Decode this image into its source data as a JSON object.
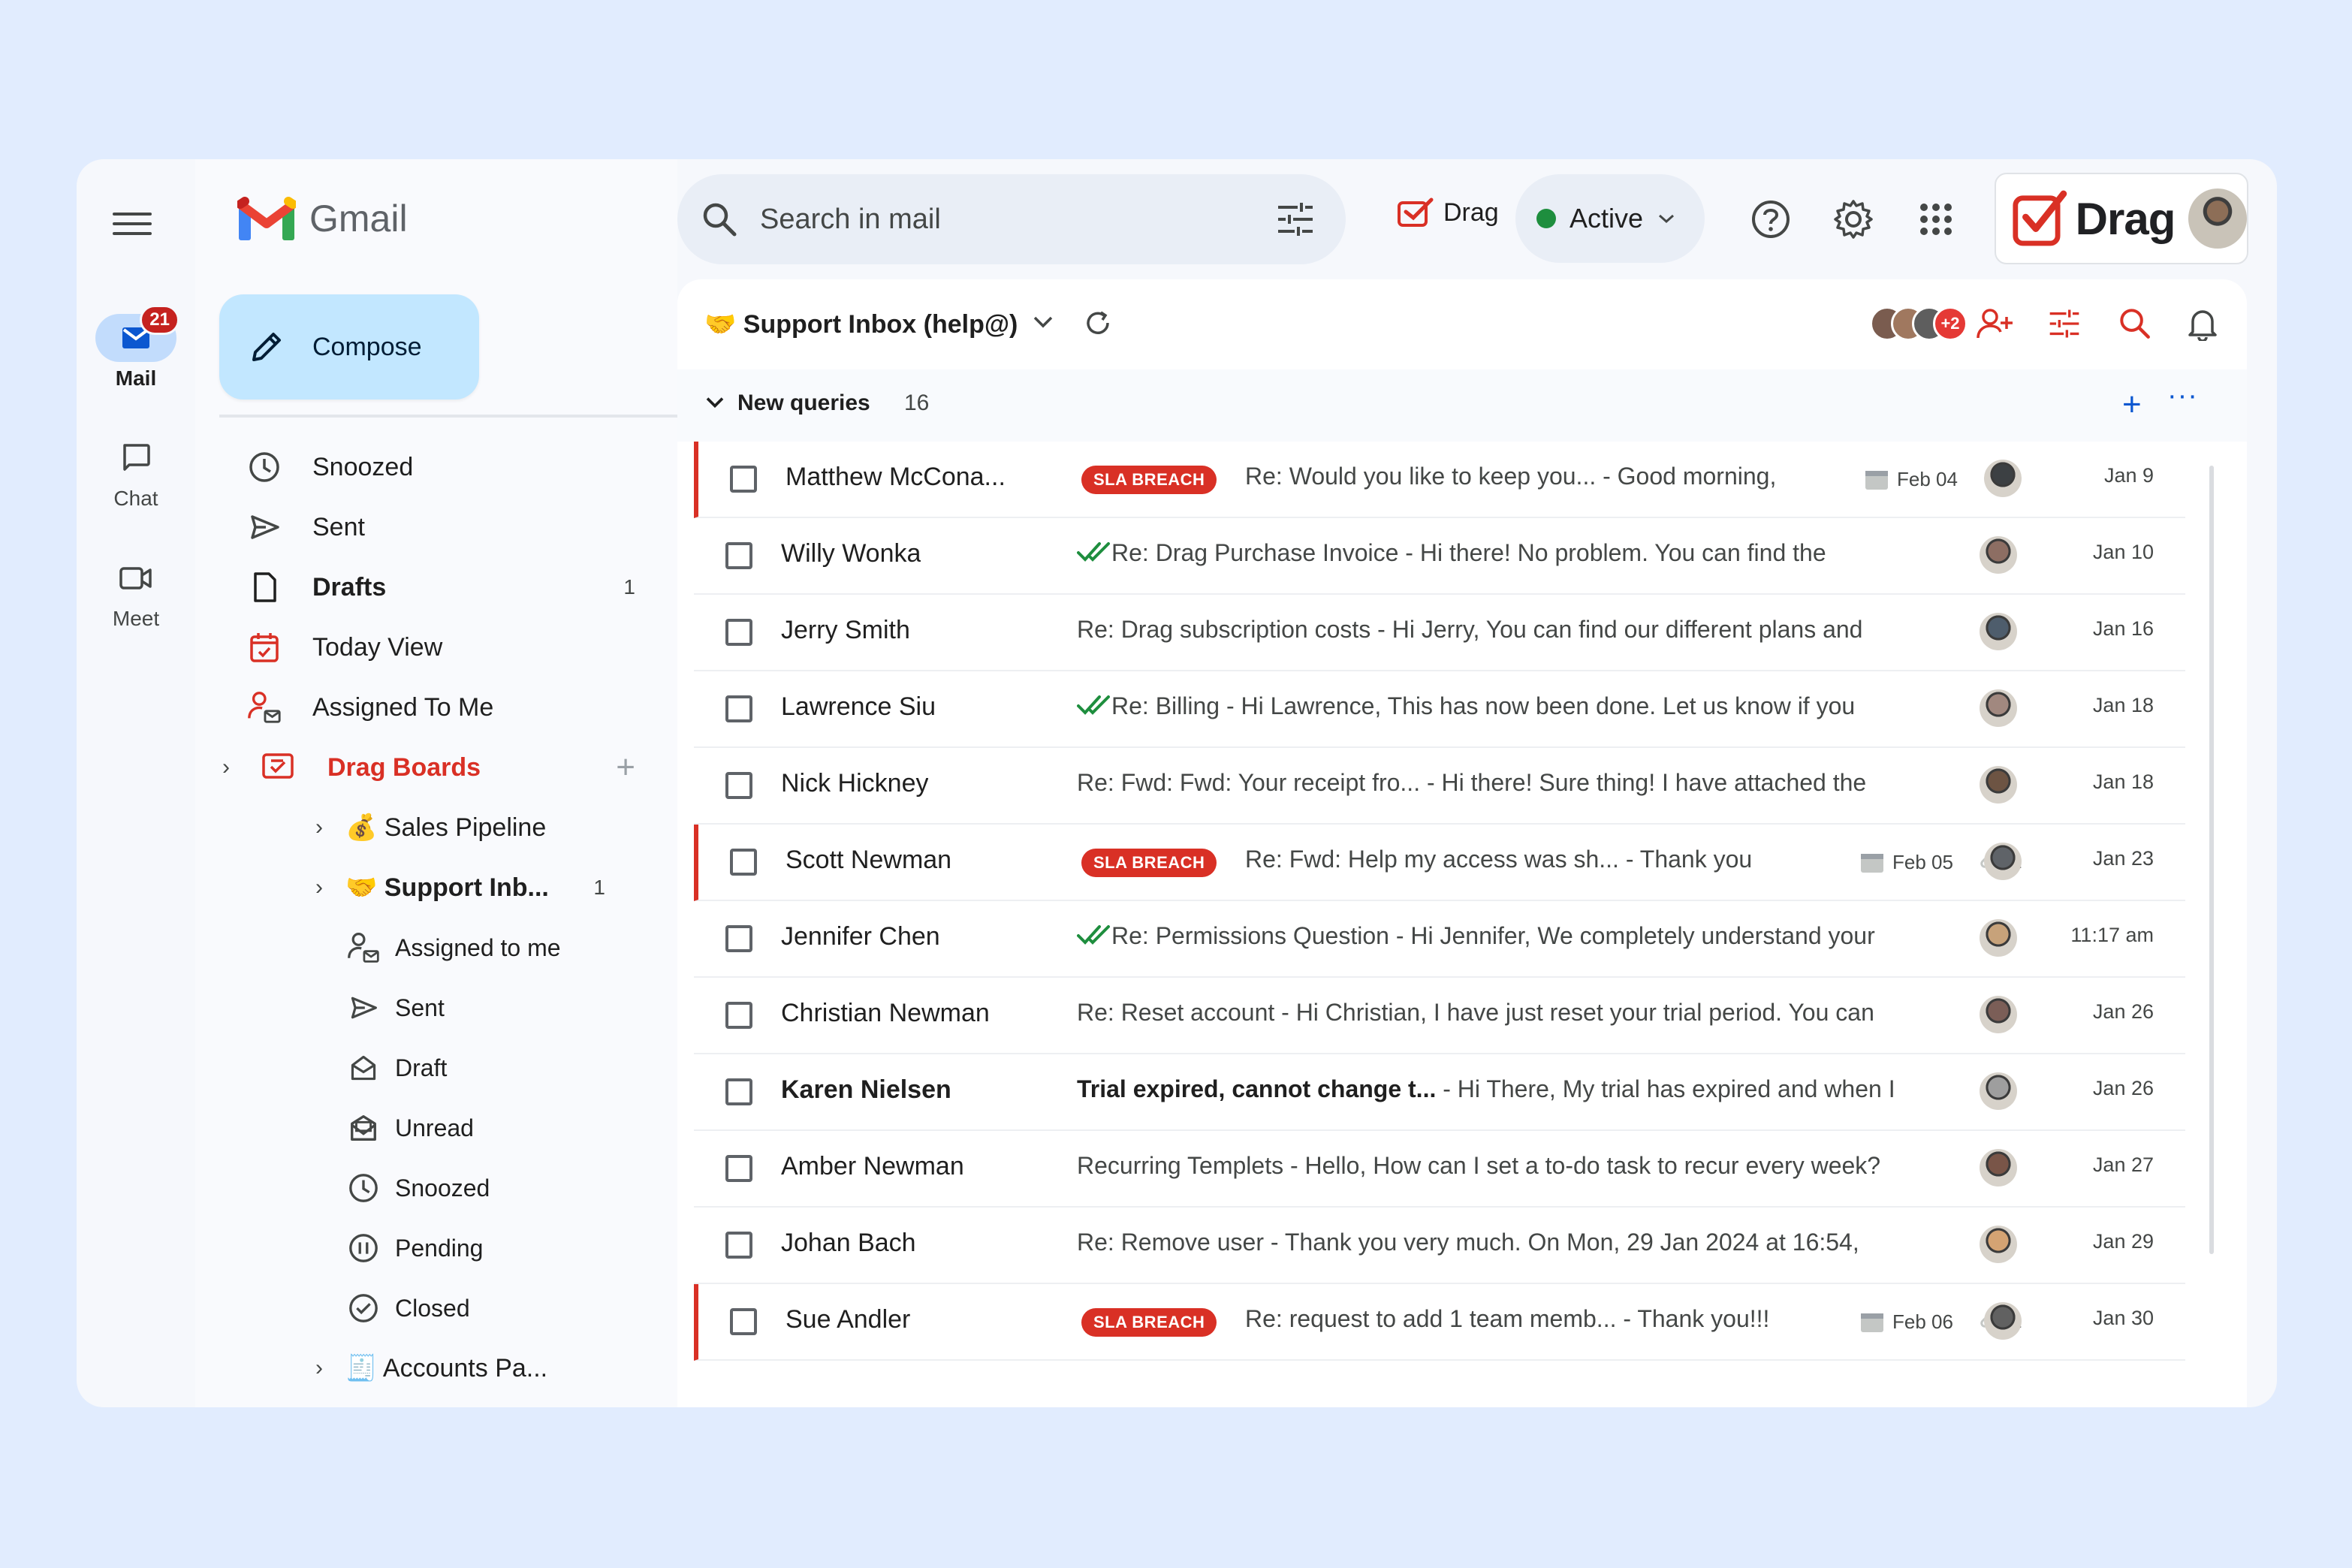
{
  "rail": {
    "items": [
      {
        "label": "Mail",
        "badge": "21"
      },
      {
        "label": "Chat"
      },
      {
        "label": "Meet"
      }
    ]
  },
  "app": {
    "name": "Gmail"
  },
  "compose": {
    "label": "Compose"
  },
  "sidebar": {
    "items": [
      {
        "label": "Snoozed",
        "icon": "clock-icon"
      },
      {
        "label": "Sent",
        "icon": "send-icon"
      },
      {
        "label": "Drafts",
        "icon": "draft-icon",
        "count": "1"
      },
      {
        "label": "Today View",
        "icon": "calendar-icon"
      },
      {
        "label": "Assigned To Me",
        "icon": "assigned-icon"
      },
      {
        "label": "Drag Boards",
        "icon": "drag-boards-icon"
      },
      {
        "label": "💰 Sales Pipeline"
      },
      {
        "label": "🤝 Support Inb...",
        "count": "1"
      },
      {
        "label": "Assigned to me",
        "icon": "assigned-icon"
      },
      {
        "label": "Sent",
        "icon": "send-icon"
      },
      {
        "label": "Draft",
        "icon": "draft-envelope-icon"
      },
      {
        "label": "Unread",
        "icon": "unread-icon"
      },
      {
        "label": "Snoozed",
        "icon": "clock-icon"
      },
      {
        "label": "Pending",
        "icon": "pause-icon"
      },
      {
        "label": "Closed",
        "icon": "check-circle-icon"
      },
      {
        "label": "🧾 Accounts Pa..."
      }
    ]
  },
  "search": {
    "placeholder": "Search in mail"
  },
  "drag_chip": {
    "label": "Drag"
  },
  "status": {
    "label": "Active",
    "color": "#1e8e3e"
  },
  "brand": {
    "text": "Drag"
  },
  "inbox": {
    "title": "🤝 Support Inbox (help@)",
    "extra_members": "+2"
  },
  "section": {
    "title": "New queries",
    "count": "16"
  },
  "sla_label": "SLA BREACH",
  "emails": [
    {
      "sender": "Matthew McCona...",
      "sla": true,
      "subject": "Re: Would you like to keep you... - Good morning,",
      "due": "Feb 04",
      "date": "Jan 9"
    },
    {
      "sender": "Willy Wonka",
      "check": true,
      "subject": "Re: Drag Purchase Invoice - Hi there! No problem. You can find the",
      "date": "Jan 10"
    },
    {
      "sender": "Jerry Smith",
      "subject": "Re: Drag subscription costs - Hi Jerry, You can find our different plans and",
      "date": "Jan 16"
    },
    {
      "sender": "Lawrence Siu",
      "check": true,
      "subject": "Re: Billing - Hi Lawrence, This has now been done. Let us know if you",
      "date": "Jan 18"
    },
    {
      "sender": "Nick Hickney",
      "subject": "Re: Fwd: Fwd: Your receipt fro... - Hi there! Sure thing! I have attached the",
      "date": "Jan 18"
    },
    {
      "sender": "Scott Newman",
      "sla": true,
      "subject": "Re: Fwd: Help my access was sh... - Thank you",
      "due": "Feb 05",
      "attachments": "1",
      "date": "Jan 23"
    },
    {
      "sender": "Jennifer Chen",
      "check": true,
      "subject": "Re: Permissions Question - Hi Jennifer, We completely understand your",
      "date": "11:17 am"
    },
    {
      "sender": "Christian Newman",
      "subject": "Re: Reset account - Hi Christian, I have just reset your trial period. You can",
      "date": "Jan 26"
    },
    {
      "sender": "Karen Nielsen",
      "unread": true,
      "subject_bold": "Trial expired, cannot change t...",
      "subject": " - Hi There, My trial has expired and when I",
      "date": "Jan 26"
    },
    {
      "sender": "Amber Newman",
      "subject": "Recurring Templets - Hello, How can I set a to-do task to recur every week?",
      "date": "Jan 27"
    },
    {
      "sender": "Johan Bach",
      "subject": "Re: Remove user - Thank you very much. On Mon, 29 Jan 2024 at 16:54,",
      "date": "Jan 29"
    },
    {
      "sender": "Sue Andler",
      "sla": true,
      "subject": "Re: request to add 1 team memb... - Thank you!!!",
      "due": "Feb 06",
      "attachments": "1",
      "date": "Jan 30"
    }
  ],
  "colors": {
    "accent_red": "#d93025",
    "compose_bg": "#c2e7ff",
    "page_bg": "#e1ecfe"
  }
}
